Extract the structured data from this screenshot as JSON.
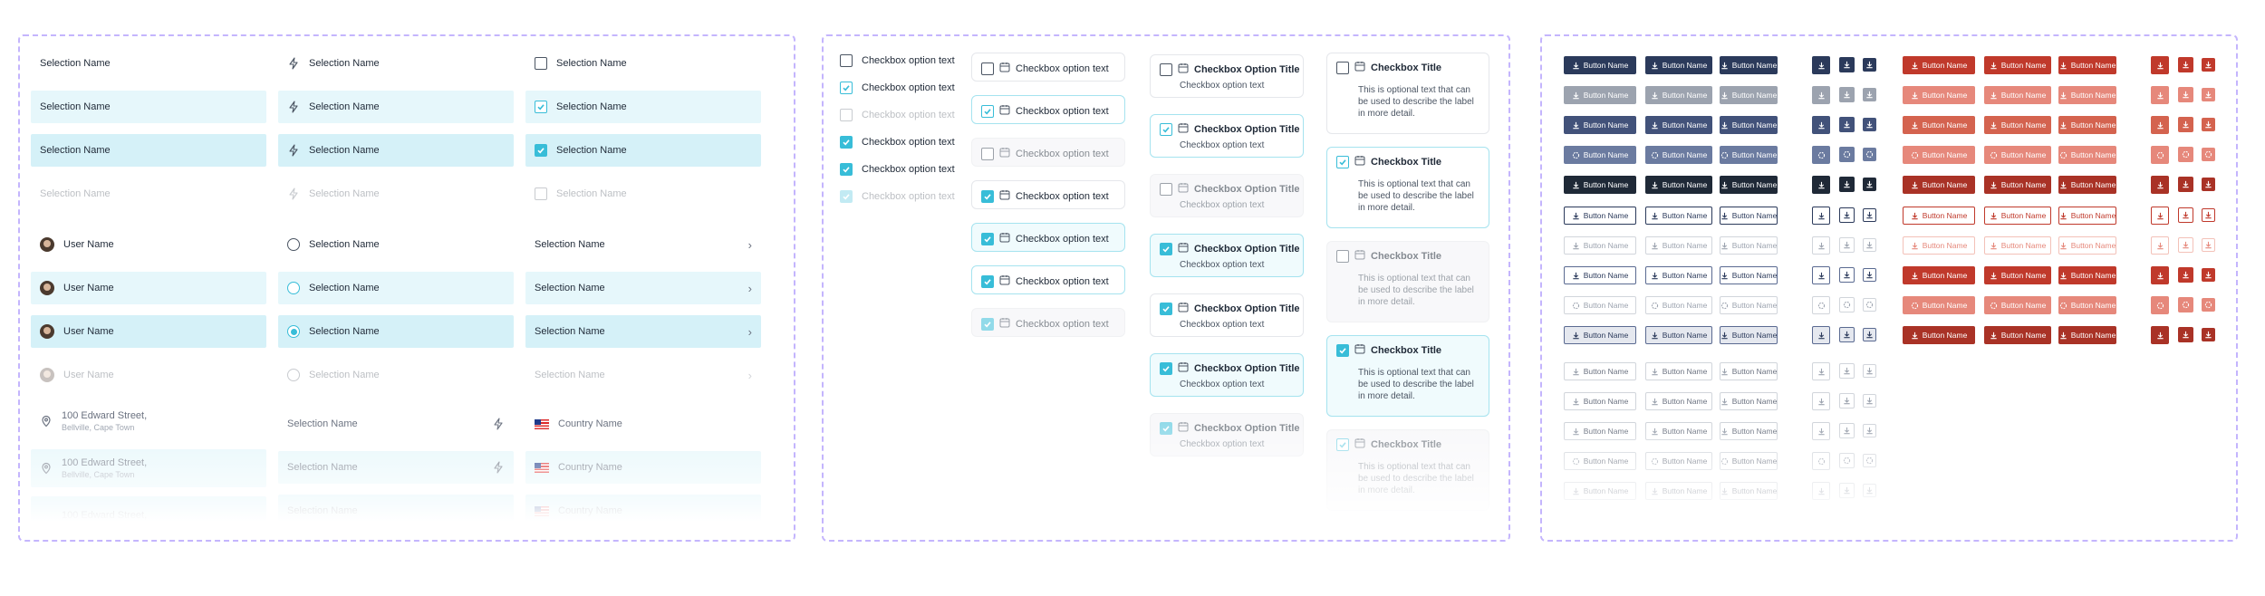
{
  "selection_panel": {
    "col1": {
      "label": "Selection Name",
      "user": "User Name",
      "address": "100 Edward Street,",
      "address_sub": "Bellville, Cape Town"
    },
    "col2": {
      "label": "Selection Name",
      "radio_label": "Selection Name",
      "plain_label": "Selection Name"
    },
    "col3": {
      "checkbox_label": "Selection Name",
      "chevron_label": "Selection Name",
      "country": "Country Name"
    }
  },
  "checkbox_panel": {
    "simple_label": "Checkbox option text",
    "boxed_label": "Checkbox option text",
    "card_title": "Checkbox Option Title",
    "card_sub": "Checkbox option text",
    "big_title": "Checkbox Title",
    "big_desc": "This is optional text that can be used to describe the label in more detail."
  },
  "button_panel": {
    "label": "Button Name"
  },
  "icons": {
    "bolt": "bolt-icon",
    "pin": "location-pin-icon",
    "calendar": "calendar-icon",
    "download": "download-icon",
    "spinner": "loading-spinner-icon",
    "chevron": "chevron-right-icon",
    "flag": "us-flag-icon"
  },
  "colors": {
    "accent": "#38bdd8",
    "navy": "#2b3a5b",
    "red": "#c0392b",
    "frame": "#c4b5fd"
  }
}
